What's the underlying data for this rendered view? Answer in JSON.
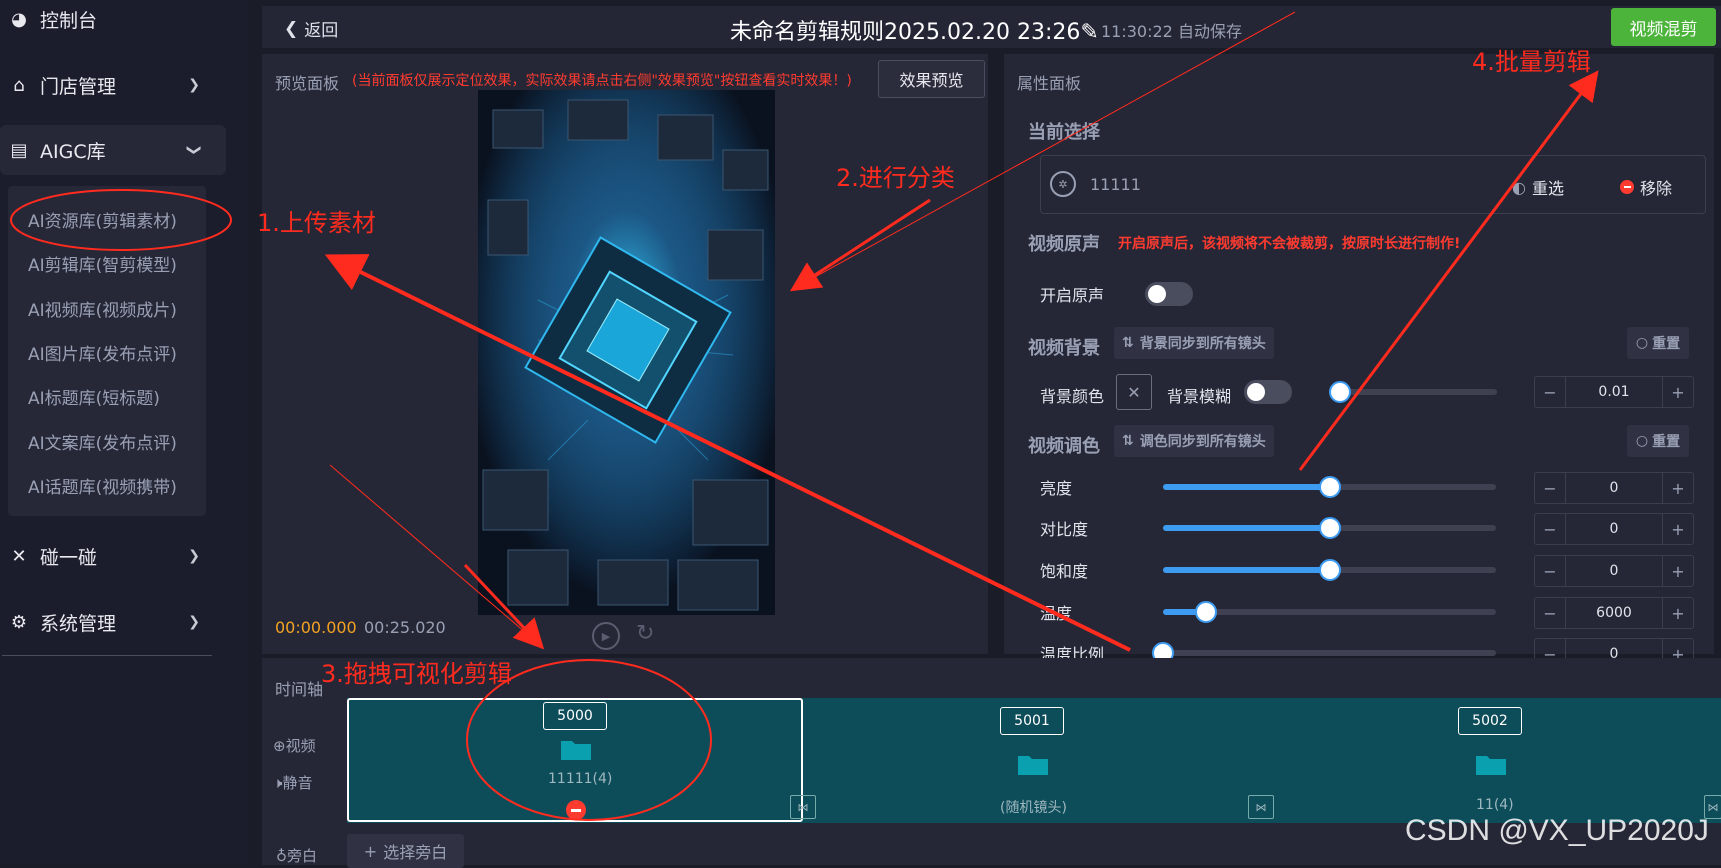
{
  "sidebar": {
    "items": [
      {
        "label": "控制台",
        "icon": "dashboard-icon"
      },
      {
        "label": "门店管理",
        "icon": "store-icon"
      },
      {
        "label": "AIGC库",
        "icon": "printer-icon"
      },
      {
        "label": "碰一碰",
        "icon": "shrink-icon"
      },
      {
        "label": "系统管理",
        "icon": "gear-icon"
      }
    ],
    "sub_items": [
      "AI资源库(剪辑素材)",
      "AI剪辑库(智剪模型)",
      "AI视频库(视频成片)",
      "AI图片库(发布点评)",
      "AI标题库(短标题)",
      "AI文案库(发布点评)",
      "AI话题库(视频携带)"
    ]
  },
  "header": {
    "back_label": "返回",
    "title": "未命名剪辑规则2025.02.20 23:26",
    "autosave": "11:30:22 自动保存",
    "mix_button": "视频混剪"
  },
  "preview": {
    "title": "预览面板",
    "notice": "(当前面板仅展示定位效果，实际效果请点击右侧\"效果预览\"按钮查看实时效果！)",
    "effect_button": "效果预览",
    "time_current": "00:00.000",
    "time_total": "00:25.020"
  },
  "props": {
    "title": "属性面板",
    "current_title": "当前选择",
    "current_value": "11111",
    "reselect": "重选",
    "remove": "移除",
    "audio_title": "视频原声",
    "audio_note": "开启原声后，该视频将不会被裁剪，按原时长进行制作!",
    "audio_toggle_label": "开启原声",
    "bg_title": "视频背景",
    "bg_sync": "背景同步到所有镜头",
    "reset": "重置",
    "bg_color_label": "背景颜色",
    "bg_blur_label": "背景模糊",
    "bg_blur_value": "0.01",
    "tone_title": "视频调色",
    "tone_sync": "调色同步到所有镜头",
    "sliders": [
      {
        "label": "亮度",
        "value": "0",
        "fraction": 0.5
      },
      {
        "label": "对比度",
        "value": "0",
        "fraction": 0.5
      },
      {
        "label": "饱和度",
        "value": "0",
        "fraction": 0.5
      },
      {
        "label": "温度",
        "value": "6000",
        "fraction": 0.13
      },
      {
        "label": "温度比例",
        "value": "0",
        "fraction": 0.0
      }
    ],
    "blur_fraction": 0.0
  },
  "timeline": {
    "title": "时间轴",
    "video_label": "视频",
    "mute_label": "静音",
    "voice_label": "旁白",
    "voice_button": "选择旁白",
    "clips": [
      {
        "id": "5000",
        "name": "11111(4)"
      },
      {
        "id": "5001",
        "name": "(随机镜头)"
      },
      {
        "id": "5002",
        "name": "11(4)"
      }
    ]
  },
  "annotations": {
    "a1": "1.上传素材",
    "a2": "2.进行分类",
    "a3": "3.拖拽可视化剪辑",
    "a4": "4.批量剪辑"
  },
  "watermark": "CSDN @VX_UP2020J",
  "colors": {
    "accent_green": "#4cb33b",
    "slider_blue": "#3d9cf2",
    "annotation_red": "#ff2b1e",
    "time_orange": "#f2a223",
    "clip_teal": "#0d4d5a"
  }
}
